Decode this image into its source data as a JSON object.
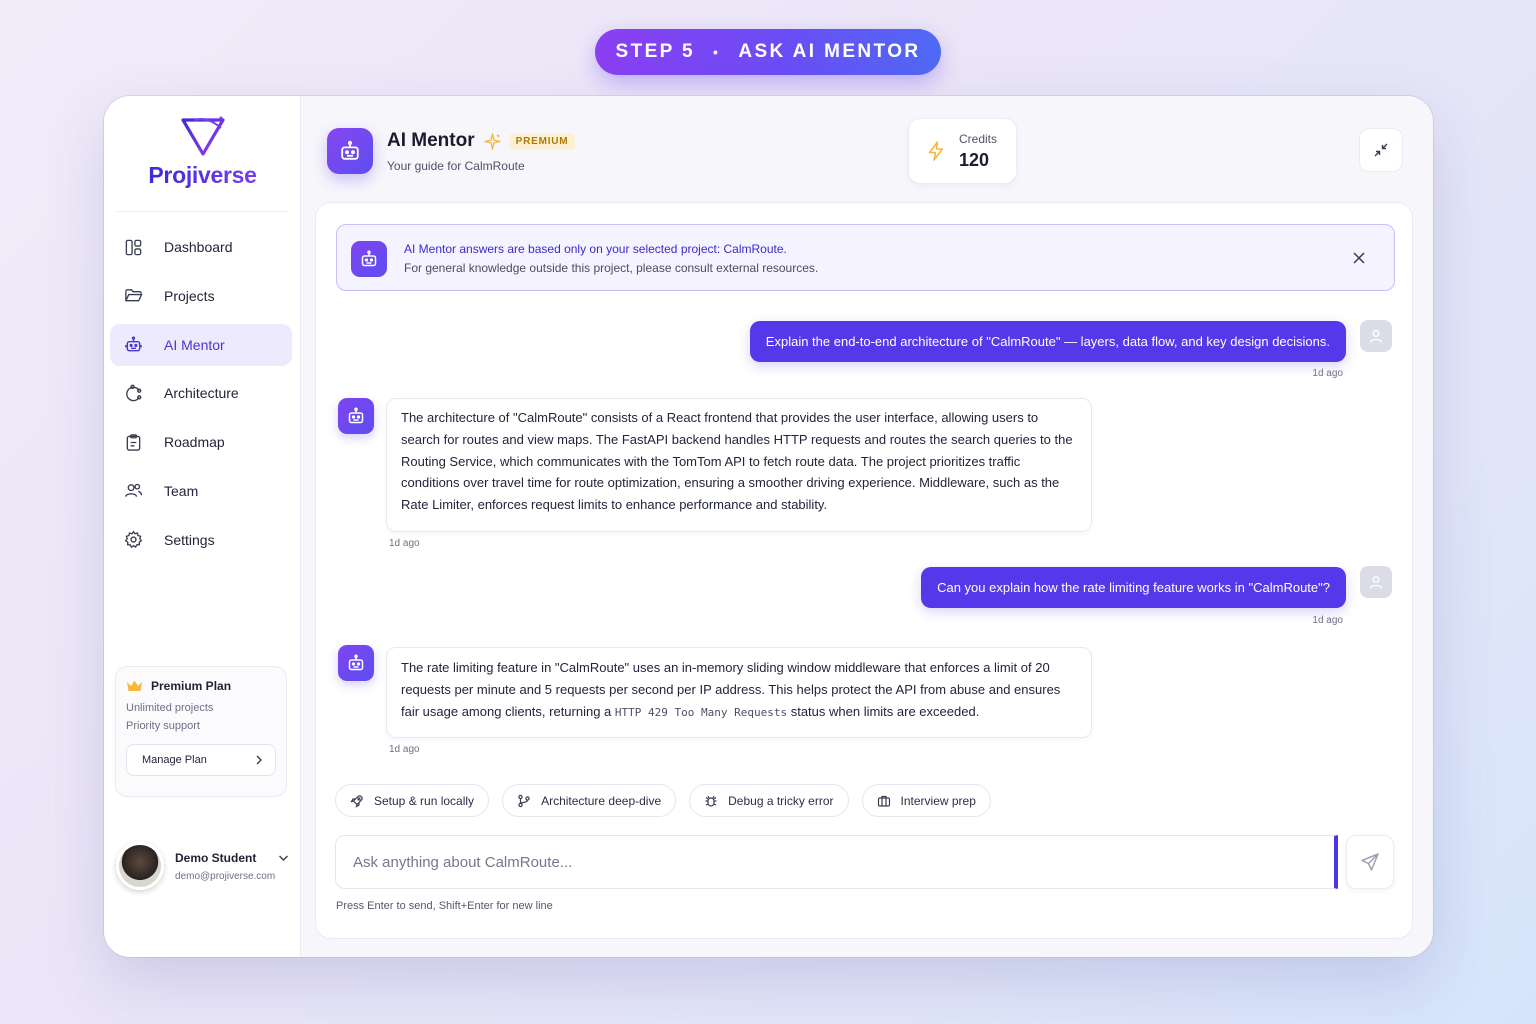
{
  "banner": {
    "step": "STEP 5",
    "separator": "•",
    "title": "ASK AI MENTOR"
  },
  "brand": {
    "name": "Projiverse"
  },
  "sidebar": {
    "items": [
      {
        "label": "Dashboard",
        "icon": "dashboard-icon",
        "active": false
      },
      {
        "label": "Projects",
        "icon": "folder-icon",
        "active": false
      },
      {
        "label": "AI Mentor",
        "icon": "robot-icon",
        "active": true
      },
      {
        "label": "Architecture",
        "icon": "architecture-icon",
        "active": false
      },
      {
        "label": "Roadmap",
        "icon": "clipboard-icon",
        "active": false
      },
      {
        "label": "Team",
        "icon": "team-icon",
        "active": false
      },
      {
        "label": "Settings",
        "icon": "gear-icon",
        "active": false
      }
    ],
    "plan": {
      "title": "Premium Plan",
      "features": [
        "Unlimited projects",
        "Priority support"
      ],
      "button": "Manage Plan"
    },
    "user": {
      "name": "Demo Student",
      "email": "demo@projiverse.com"
    }
  },
  "header": {
    "title": "AI Mentor",
    "badge": "PREMIUM",
    "subtitle": "Your guide for CalmRoute",
    "credits_label": "Credits",
    "credits_value": "120"
  },
  "notice": {
    "title": "AI Mentor answers are based only on your selected project: CalmRoute.",
    "text": "For general knowledge outside this project, please consult external resources."
  },
  "messages": [
    {
      "role": "user",
      "text": "Explain the end-to-end architecture of \"CalmRoute\" — layers, data flow, and key design decisions.",
      "time": "1d ago"
    },
    {
      "role": "assistant",
      "text": "The architecture of \"CalmRoute\" consists of a React frontend that provides the user interface, allowing users to search for routes and view maps. The FastAPI backend handles HTTP requests and routes the search queries to the Routing Service, which communicates with the TomTom API to fetch route data. The project prioritizes traffic conditions over travel time for route optimization, ensuring a smoother driving experience. Middleware, such as the Rate Limiter, enforces request limits to enhance performance and stability.",
      "time": "1d ago"
    },
    {
      "role": "user",
      "text": "Can you explain how the rate limiting feature works in \"CalmRoute\"?",
      "time": "1d ago"
    },
    {
      "role": "assistant",
      "text_before": "The rate limiting feature in \"CalmRoute\" uses an in-memory sliding window middleware that enforces a limit of 20 requests per minute and 5 requests per second per IP address. This helps protect the API from abuse and ensures fair usage among clients, returning a ",
      "code": "HTTP 429 Too Many Requests",
      "text_after": " status when limits are exceeded.",
      "time": "1d ago"
    }
  ],
  "suggestions": [
    "Setup & run locally",
    "Architecture deep-dive",
    "Debug a tricky error",
    "Interview prep"
  ],
  "composer": {
    "placeholder": "Ask anything about CalmRoute...",
    "hint": "Press Enter to send, Shift+Enter for new line"
  },
  "colors": {
    "accent": "#5438e9",
    "premium": "#b07708",
    "credits_icon": "#f4b740"
  }
}
